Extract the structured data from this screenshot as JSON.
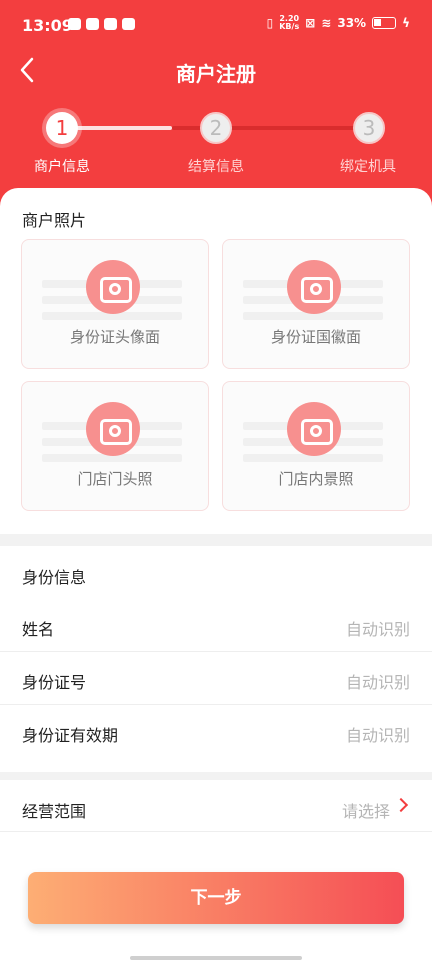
{
  "status": {
    "time": "13:09",
    "speed_top": "2.20",
    "speed_bottom": "KB/s",
    "battery": "33%"
  },
  "nav": {
    "title": "商户注册"
  },
  "steps": [
    {
      "num": "1",
      "label": "商户信息"
    },
    {
      "num": "2",
      "label": "结算信息"
    },
    {
      "num": "3",
      "label": "绑定机具"
    }
  ],
  "photos": {
    "title": "商户照片",
    "items": [
      "身份证头像面",
      "身份证国徽面",
      "门店门头照",
      "门店内景照"
    ]
  },
  "identity": {
    "title": "身份信息",
    "rows": [
      {
        "label": "姓名",
        "value": "自动识别"
      },
      {
        "label": "身份证号",
        "value": "自动识别"
      },
      {
        "label": "身份证有效期",
        "value": "自动识别"
      }
    ]
  },
  "business": {
    "label": "经营范围",
    "placeholder": "请选择"
  },
  "actions": {
    "next": "下一步"
  },
  "colors": {
    "primary": "#f33e3f",
    "button_start": "#fdae74",
    "button_end": "#f54e55"
  }
}
